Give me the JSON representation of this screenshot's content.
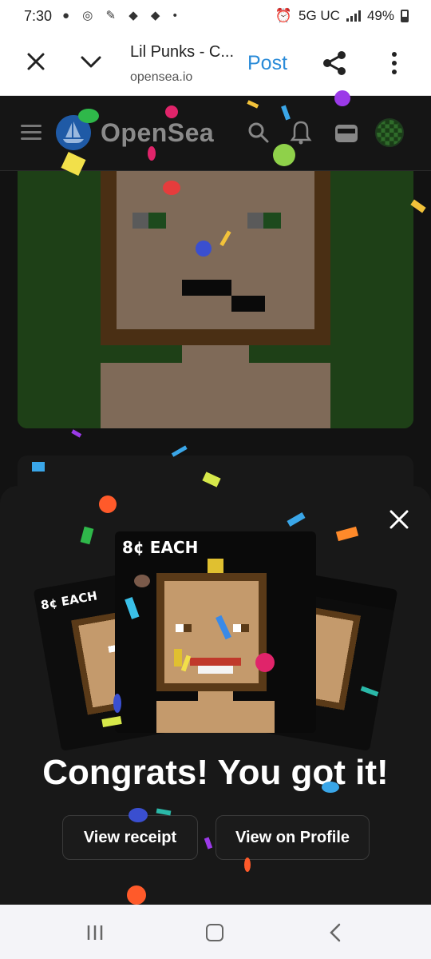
{
  "status_bar": {
    "time": "7:30",
    "network": "5G UC",
    "battery": "49%"
  },
  "toolbar": {
    "title": "Lil Punks - C...",
    "url": "opensea.io",
    "post_label": "Post"
  },
  "opensea": {
    "brand": "OpenSea"
  },
  "modal": {
    "price_main": "8¢ EACH",
    "price_back": "8¢ EACH",
    "congrats": "Congrats! You got it!",
    "receipt_button": "View receipt",
    "profile_button": "View on Profile"
  },
  "colors": {
    "link_blue": "#2a8bd8",
    "page_bg": "#121212",
    "modal_bg": "#181818",
    "nft_bg": "#1e4017"
  }
}
